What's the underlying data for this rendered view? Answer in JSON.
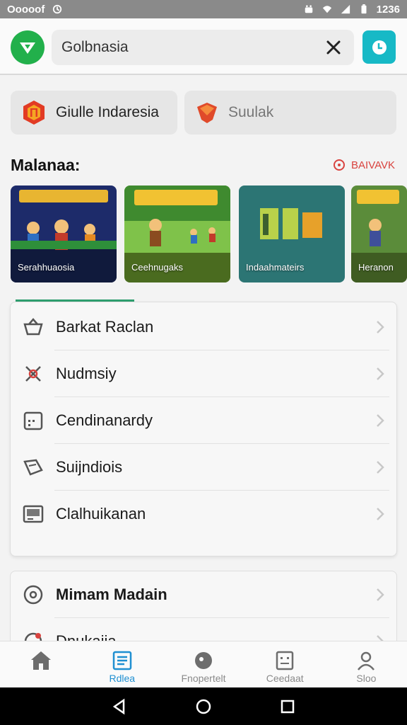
{
  "status_bar": {
    "carrier": "Ooooof",
    "time": "1236"
  },
  "search": {
    "value": "Golbnasia",
    "icons": [
      "logo-arrow-icon",
      "close-icon",
      "clock-icon"
    ]
  },
  "chips": [
    {
      "label": "Giulle Indaresia",
      "icon": "brand-m-icon"
    },
    {
      "label": "Suulak",
      "icon": "shield-icon"
    }
  ],
  "section": {
    "title": "Malanaa:",
    "link_label": "BAIVAVK"
  },
  "games": [
    {
      "label": "Serahhuaosia"
    },
    {
      "label": "Ceehnugaks"
    },
    {
      "label": "Indaahmateirs"
    },
    {
      "label": "Heranon"
    }
  ],
  "menu": [
    {
      "label": "Barkat Raclan",
      "icon": "basket-icon"
    },
    {
      "label": "Nudmsiy",
      "icon": "tools-icon"
    },
    {
      "label": "Cendinanardy",
      "icon": "calendar-icon"
    },
    {
      "label": "Suijndiois",
      "icon": "ticket-icon"
    },
    {
      "label": "Clalhuikanan",
      "icon": "monitor-icon"
    }
  ],
  "menu2": [
    {
      "label": "Mimam Madain",
      "icon": "target-icon"
    },
    {
      "label": "Dnukaiia",
      "icon": "pin-icon"
    }
  ],
  "bottom_nav": [
    {
      "label": "",
      "icon": "home-icon"
    },
    {
      "label": "Rdlea",
      "icon": "document-icon"
    },
    {
      "label": "Fnopertelt",
      "icon": "disc-icon"
    },
    {
      "label": "Ceedaat",
      "icon": "card-icon"
    },
    {
      "label": "Sloo",
      "icon": "person-icon"
    }
  ],
  "colors": {
    "accent_green": "#22b04b",
    "accent_teal": "#17b9c6",
    "link_red": "#d9433f",
    "active_blue": "#1f8fd1"
  }
}
